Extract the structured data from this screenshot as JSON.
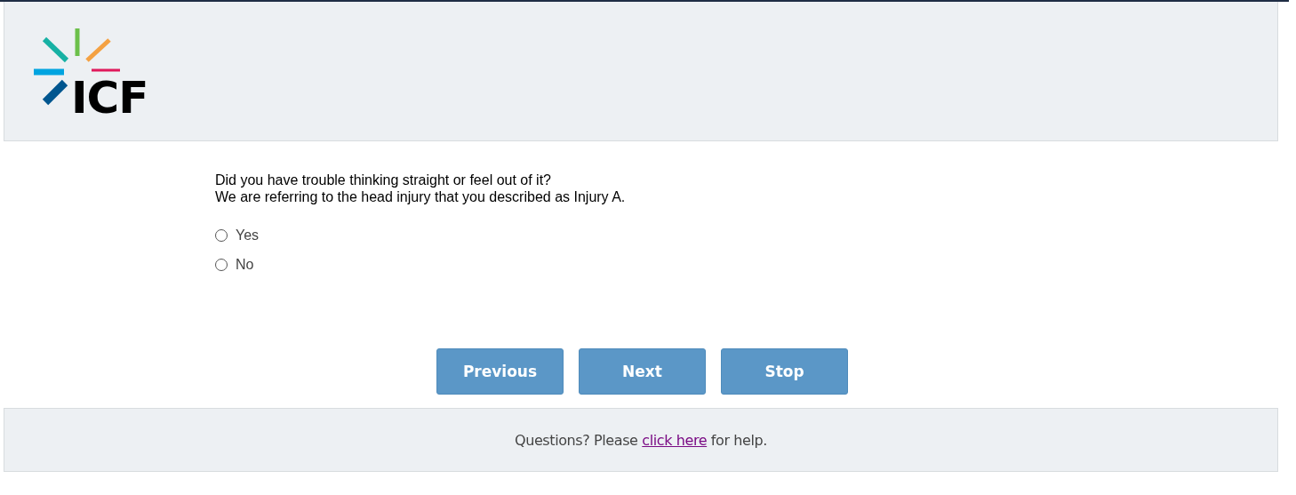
{
  "header": {
    "logo_text": "ICF"
  },
  "question": {
    "lines": [
      "Did you have trouble thinking straight or feel out of it?",
      "We are referring to the head injury that you described as Injury A."
    ]
  },
  "options": [
    {
      "label": "Yes",
      "selected": false
    },
    {
      "label": "No",
      "selected": false
    }
  ],
  "buttons": [
    "Previous",
    "Next",
    "Stop"
  ],
  "footer": {
    "before": "Questions? Please ",
    "link": "click here",
    "after": " for help."
  }
}
